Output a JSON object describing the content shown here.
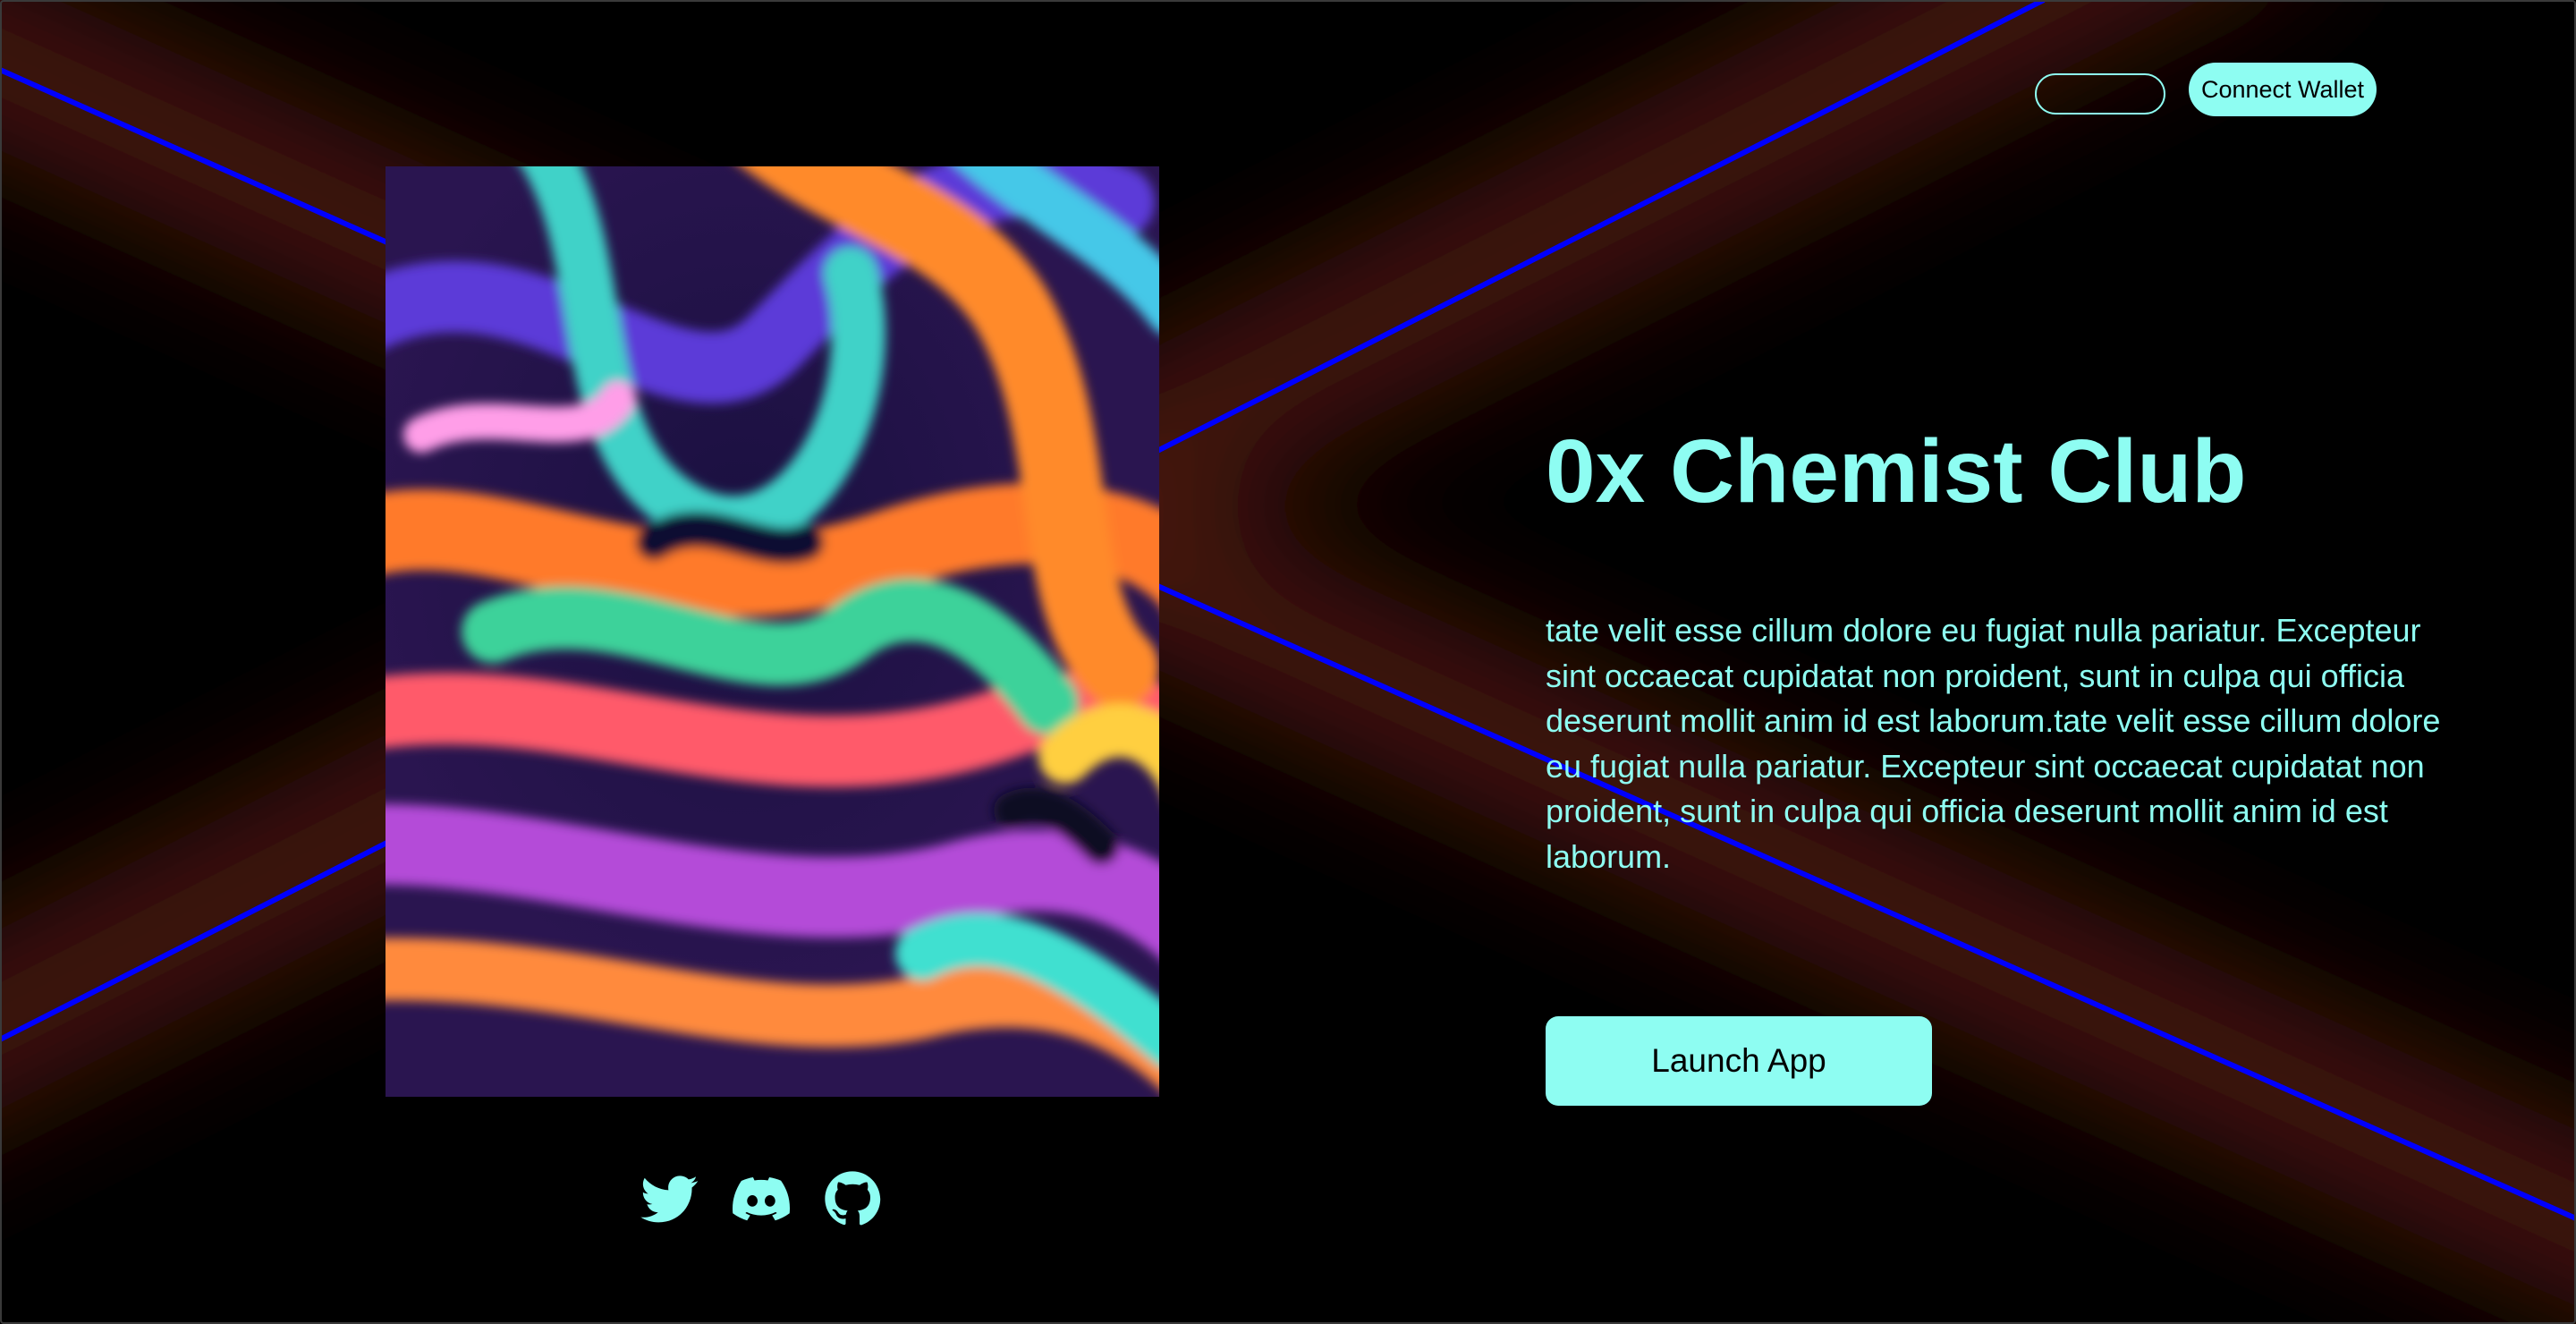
{
  "header": {
    "secondary_button_label": "",
    "connect_wallet_label": "Connect Wallet"
  },
  "hero": {
    "title": "0x Chemist Club",
    "description": "tate velit esse cillum dolore eu fugiat nulla pariatur. Excepteur sint occaecat cupidatat non proident, sunt in culpa qui officia deserunt mollit anim id est laborum.tate velit esse cillum dolore eu fugiat nulla pariatur. Excepteur sint occaecat cupidatat non proident, sunt in culpa qui officia deserunt mollit anim id est laborum.",
    "launch_label": "Launch App"
  },
  "socials": [
    {
      "icon": "twitter-icon"
    },
    {
      "icon": "discord-icon"
    },
    {
      "icon": "github-icon"
    }
  ],
  "colors": {
    "accent": "#8efdf2",
    "background": "#000000",
    "line": "#0000ff",
    "glow": "#3d0e08"
  }
}
